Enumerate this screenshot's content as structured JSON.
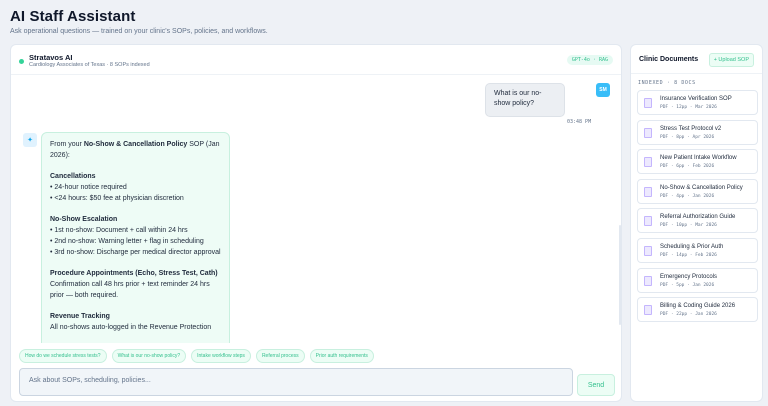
{
  "header": {
    "title": "AI Staff Assistant",
    "subtitle": "Ask operational questions — trained on your clinic's SOPs, policies, and workflows."
  },
  "chat": {
    "assistant_name": "Stratavos AI",
    "assistant_meta": "Cardiology Associates of Texas · 8 SOPs indexed",
    "model_badge": "GPT-4o · RAG",
    "user_message": "What is our no-show policy?",
    "user_initials": "SM",
    "user_time": "03:48 PM",
    "bot_icon": "✦",
    "bot_response": {
      "intro_prefix": "From your ",
      "intro_policy": "No-Show & Cancellation Policy",
      "intro_suffix": " SOP (Jan 2026):",
      "sections": [
        {
          "title": "Cancellations",
          "lines": [
            "• 24-hour notice required",
            "• <24 hours: $50 fee at physician discretion"
          ]
        },
        {
          "title": "No-Show Escalation",
          "lines": [
            "• 1st no-show: Document + call within 24 hrs",
            "• 2nd no-show: Warning letter + flag in scheduling",
            "• 3rd no-show: Discharge per medical director approval"
          ]
        },
        {
          "title": "Procedure Appointments (Echo, Stress Test, Cath)",
          "lines": [
            "Confirmation call 48 hrs prior + text reminder 24 hrs prior — both required."
          ]
        },
        {
          "title": "Revenue Tracking",
          "lines": [
            "All no-shows auto-logged in the Revenue Protection"
          ]
        }
      ]
    },
    "suggestions": [
      "How do we schedule stress tests?",
      "What is our no-show policy?",
      "Intake workflow steps",
      "Referral process",
      "Prior auth requirements"
    ],
    "input_placeholder": "Ask about SOPs, scheduling, policies...",
    "send_label": "Send"
  },
  "docs": {
    "title": "Clinic Documents",
    "upload_label": "+ Upload SOP",
    "indexed_label": "INDEXED · 8 DOCS",
    "items": [
      {
        "name": "Insurance Verification SOP",
        "meta": "PDF · 12pp · Mar 2026"
      },
      {
        "name": "Stress Test Protocol v2",
        "meta": "PDF · 8pp · Apr 2026"
      },
      {
        "name": "New Patient Intake Workflow",
        "meta": "PDF · 6pp · Feb 2026"
      },
      {
        "name": "No-Show & Cancellation Policy",
        "meta": "PDF · 4pp · Jan 2026"
      },
      {
        "name": "Referral Authorization Guide",
        "meta": "PDF · 10pp · Mar 2026"
      },
      {
        "name": "Scheduling & Prior Auth",
        "meta": "PDF · 14pp · Feb 2026"
      },
      {
        "name": "Emergency Protocols",
        "meta": "PDF · 5pp · Jan 2026"
      },
      {
        "name": "Billing & Coding Guide 2026",
        "meta": "PDF · 22pp · Jan 2026"
      }
    ]
  },
  "colors": {
    "accent": "#34c08e",
    "status": "#34d399",
    "avatar": "#38bdf8"
  }
}
